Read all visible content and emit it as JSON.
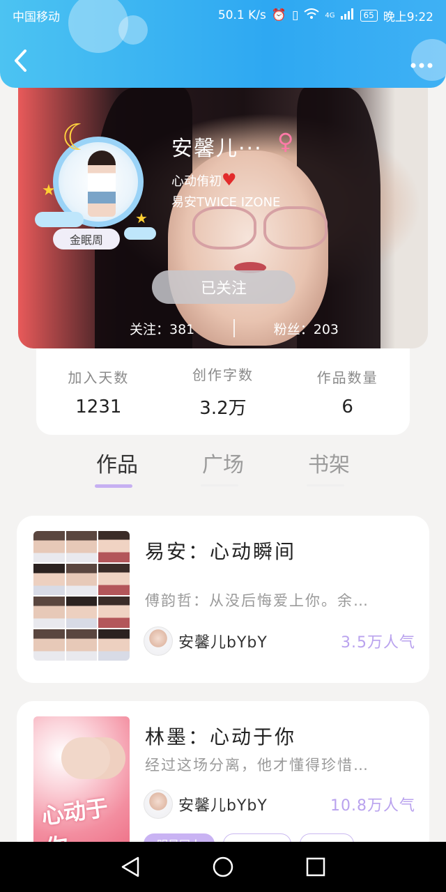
{
  "status_bar": {
    "carrier": "中国移动",
    "speed": "50.1 K/s",
    "network": "4G",
    "battery": "65",
    "time": "晚上9:22"
  },
  "nav": {
    "back_icon": "chevron-left-icon",
    "more_icon": "more-dots-icon"
  },
  "profile": {
    "name": "安馨儿···",
    "gender_symbol": "♀",
    "bio_line1": "心动侑初",
    "bio_line2": "易安TWICE IZONE",
    "badge": "金眠周",
    "follow_button": "已关注",
    "following_label": "关注：381",
    "fans_label": "粉丝：203"
  },
  "stats": [
    {
      "label": "加入天数",
      "value": "1231"
    },
    {
      "label": "创作字数",
      "value": "3.2万"
    },
    {
      "label": "作品数量",
      "value": "6"
    }
  ],
  "tabs": [
    {
      "label": "作品",
      "active": true
    },
    {
      "label": "广场",
      "active": false
    },
    {
      "label": "书架",
      "active": false
    }
  ],
  "works": [
    {
      "title": "易安：心动瞬间",
      "description": "傅韵哲：从没后悔爱上你。余…",
      "author": "安馨儿bYbY",
      "popularity": "3.5万人气"
    },
    {
      "title": "林墨：心动于你",
      "description": "经过这场分离，他才懂得珍惜…",
      "author": "安馨儿bYbY",
      "popularity": "10.8万人气",
      "cover_text": "心动于你",
      "tags": [
        "明星同人",
        "",
        ""
      ]
    }
  ],
  "colors": {
    "header_blue": "#2ea8f2",
    "accent_purple": "#b9a2ee",
    "gender_pink": "#ff7aa8"
  }
}
